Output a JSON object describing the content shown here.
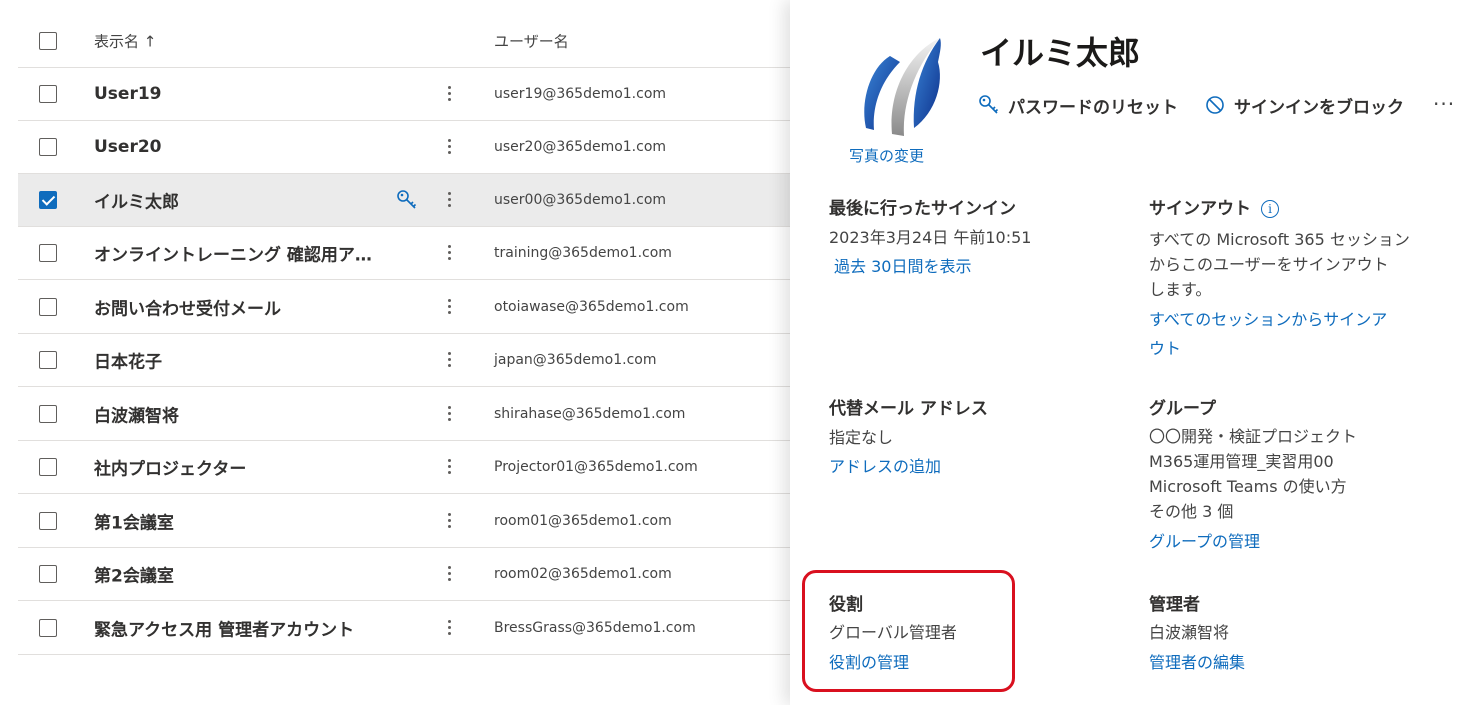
{
  "list": {
    "header": {
      "display_name": "表示名 ↑",
      "user_name": "ユーザー名"
    },
    "rows": [
      {
        "name": "User19",
        "email": "user19@365demo1.com",
        "checked": false
      },
      {
        "name": "User20",
        "email": "user20@365demo1.com",
        "checked": false
      },
      {
        "name": "イルミ太郎",
        "email": "user00@365demo1.com",
        "checked": true
      },
      {
        "name": "オンライントレーニング 確認用ア…",
        "email": "training@365demo1.com",
        "checked": false
      },
      {
        "name": "お問い合わせ受付メール",
        "email": "otoiawase@365demo1.com",
        "checked": false
      },
      {
        "name": "日本花子",
        "email": "japan@365demo1.com",
        "checked": false
      },
      {
        "name": "白波瀬智将",
        "email": "shirahase@365demo1.com",
        "checked": false
      },
      {
        "name": "社内プロジェクター",
        "email": "Projector01@365demo1.com",
        "checked": false
      },
      {
        "name": "第1会議室",
        "email": "room01@365demo1.com",
        "checked": false
      },
      {
        "name": "第2会議室",
        "email": "room02@365demo1.com",
        "checked": false
      },
      {
        "name": "緊急アクセス用 管理者アカウント",
        "email": "BressGrass@365demo1.com",
        "checked": false
      }
    ]
  },
  "panel": {
    "title": "イルミ太郎",
    "photo_link": "写真の変更",
    "actions": {
      "reset_password": "パスワードのリセット",
      "block_signin": "サインインをブロック",
      "more": "···"
    },
    "last_signin": {
      "heading": "最後に行ったサインイン",
      "value": "2023年3月24日 午前10:51",
      "link": "過去 30日間を表示"
    },
    "signout": {
      "heading": "サインアウト",
      "info_icon": "i",
      "text_lines": [
        "すべての Microsoft 365 セッション",
        "からこのユーザーをサインアウト",
        "します。"
      ],
      "link_lines": [
        "すべてのセッションからサインア",
        "ウト"
      ]
    },
    "alt_email": {
      "heading": "代替メール アドレス",
      "value": "指定なし",
      "link": "アドレスの追加"
    },
    "groups": {
      "heading": "グループ",
      "items": [
        "〇〇開発・検証プロジェクト",
        "M365運用管理_実習用00",
        "Microsoft Teams の使い方",
        "その他 3 個"
      ],
      "link": "グループの管理"
    },
    "roles": {
      "heading": "役割",
      "value": "グローバル管理者",
      "link": "役割の管理"
    },
    "manager": {
      "heading": "管理者",
      "value": "白波瀬智将",
      "link": "管理者の編集"
    }
  },
  "colors": {
    "accent": "#0f6cbd",
    "highlight_box": "#d9101f",
    "selected_row": "#ebebeb"
  },
  "icons": {
    "key": "key-icon",
    "block": "block-icon",
    "info": "info-icon",
    "more": "more-icon",
    "row_menu": "more-vertical-icon"
  }
}
